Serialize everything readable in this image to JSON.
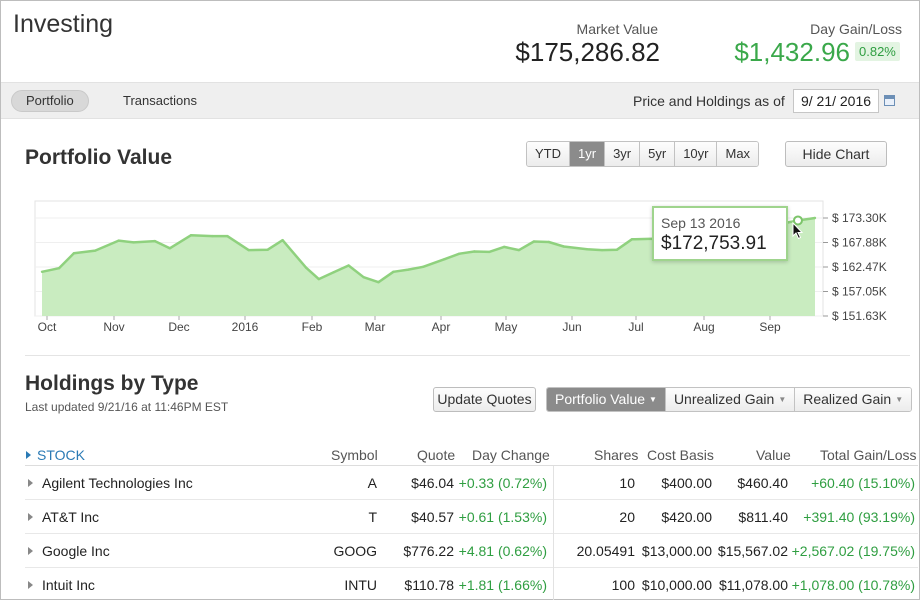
{
  "header": {
    "title": "Investing",
    "market_value_label": "Market Value",
    "market_value": "$175,286.82",
    "day_gain_label": "Day Gain/Loss",
    "day_gain": "$1,432.96",
    "day_gain_pct": "0.82%"
  },
  "tabs": [
    {
      "label": "Portfolio",
      "active": true
    },
    {
      "label": "Transactions",
      "active": false
    }
  ],
  "as_of": {
    "label": "Price and Holdings as of",
    "date": "9/ 21/ 2016",
    "icon": "calendar-icon"
  },
  "portfolio": {
    "title": "Portfolio Value",
    "ranges": [
      "YTD",
      "1yr",
      "3yr",
      "5yr",
      "10yr",
      "Max"
    ],
    "active_range": "1yr",
    "hide_chart_label": "Hide Chart",
    "tooltip": {
      "date": "Sep 13 2016",
      "value": "$172,753.91"
    }
  },
  "chart_data": {
    "type": "area",
    "color": "#8fd17e",
    "fill": "#c9ecc0",
    "xlabels": [
      "Oct",
      "Nov",
      "Dec",
      "2016",
      "Feb",
      "Mar",
      "Apr",
      "May",
      "Jun",
      "Jul",
      "Aug",
      "Sep"
    ],
    "yticks": [
      "$ 173.30K",
      "$ 167.88K",
      "$ 162.47K",
      "$ 157.05K",
      "$ 151.63K"
    ],
    "ylim": [
      151630,
      173300
    ],
    "x": [
      "2015-09-24",
      "2015-10-02",
      "2015-10-09",
      "2015-10-19",
      "2015-10-30",
      "2015-11-06",
      "2015-11-16",
      "2015-11-23",
      "2015-12-03",
      "2015-12-13",
      "2015-12-20",
      "2015-12-30",
      "2016-01-08",
      "2016-01-15",
      "2016-01-26",
      "2016-02-01",
      "2016-02-08",
      "2016-02-15",
      "2016-02-22",
      "2016-02-29",
      "2016-03-07",
      "2016-03-14",
      "2016-03-21",
      "2016-03-31",
      "2016-04-07",
      "2016-04-14",
      "2016-04-21",
      "2016-04-28",
      "2016-05-05",
      "2016-05-12",
      "2016-05-19",
      "2016-05-26",
      "2016-06-06",
      "2016-06-13",
      "2016-06-20",
      "2016-06-27",
      "2016-07-07",
      "2016-07-14",
      "2016-07-21",
      "2016-07-28",
      "2016-08-04",
      "2016-08-11",
      "2016-08-18",
      "2016-08-25",
      "2016-09-01",
      "2016-09-06",
      "2016-09-13",
      "2016-09-21"
    ],
    "values": [
      161400,
      162200,
      165500,
      166100,
      168300,
      167900,
      168200,
      166600,
      169500,
      169300,
      169300,
      166200,
      166300,
      168400,
      162300,
      159800,
      161300,
      162800,
      160200,
      159100,
      161400,
      161900,
      162500,
      164200,
      165400,
      165900,
      165800,
      166900,
      166200,
      168100,
      168000,
      167000,
      166400,
      166200,
      166300,
      168600,
      168700,
      168200,
      168200,
      168000,
      167500,
      166400,
      170000,
      170000,
      170500,
      172100,
      172754,
      173300
    ]
  },
  "holdings": {
    "title": "Holdings by Type",
    "updated": "Last updated 9/21/16 at 11:46PM EST",
    "update_quotes_label": "Update Quotes",
    "views": [
      "Portfolio Value",
      "Unrealized Gain",
      "Realized Gain"
    ],
    "active_view": "Portfolio Value",
    "group": "STOCK",
    "columns": {
      "symbol": "Symbol",
      "quote": "Quote",
      "day_change": "Day Change",
      "shares": "Shares",
      "cost_basis": "Cost Basis",
      "value": "Value",
      "total_gain": "Total Gain/Loss"
    },
    "rows": [
      {
        "name": "Agilent Technologies Inc",
        "symbol": "A",
        "quote": "$46.04",
        "day_change": "+0.33 (0.72%)",
        "shares": "10",
        "cost_basis": "$400.00",
        "value": "$460.40",
        "total_gain": "+60.40 (15.10%)"
      },
      {
        "name": "AT&T Inc",
        "symbol": "T",
        "quote": "$40.57",
        "day_change": "+0.61 (1.53%)",
        "shares": "20",
        "cost_basis": "$420.00",
        "value": "$811.40",
        "total_gain": "+391.40 (93.19%)"
      },
      {
        "name": "Google Inc",
        "symbol": "GOOG",
        "quote": "$776.22",
        "day_change": "+4.81 (0.62%)",
        "shares": "20.05491",
        "cost_basis": "$13,000.00",
        "value": "$15,567.02",
        "total_gain": "+2,567.02 (19.75%)"
      },
      {
        "name": "Intuit Inc",
        "symbol": "INTU",
        "quote": "$110.78",
        "day_change": "+1.81 (1.66%)",
        "shares": "100",
        "cost_basis": "$10,000.00",
        "value": "$11,078.00",
        "total_gain": "+1,078.00 (10.78%)"
      }
    ]
  }
}
